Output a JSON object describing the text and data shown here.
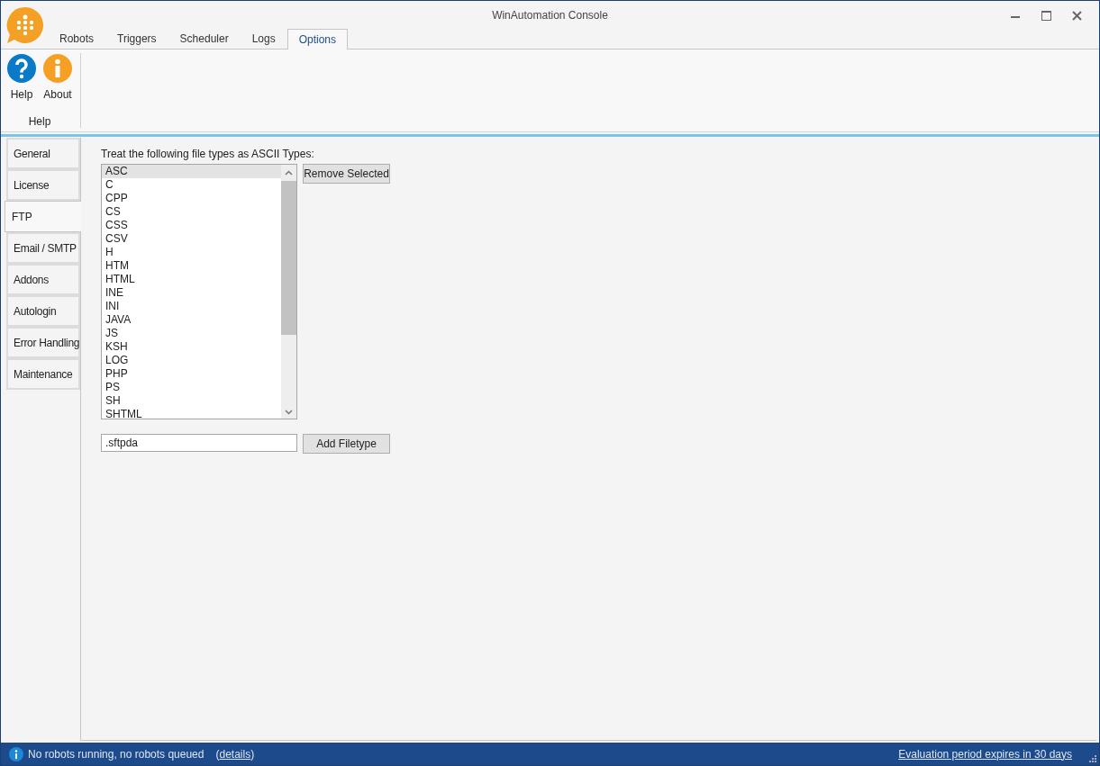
{
  "window": {
    "title": "WinAutomation Console"
  },
  "ribbon_tabs": [
    {
      "label": "Robots",
      "selected": false
    },
    {
      "label": "Triggers",
      "selected": false
    },
    {
      "label": "Scheduler",
      "selected": false
    },
    {
      "label": "Logs",
      "selected": false
    },
    {
      "label": "Options",
      "selected": true
    }
  ],
  "ribbon_buttons": [
    {
      "label": "Help",
      "kind": "help"
    },
    {
      "label": "About",
      "kind": "about"
    }
  ],
  "ribbon_group": "Help",
  "side_tabs": [
    {
      "label": "General",
      "selected": false
    },
    {
      "label": "License",
      "selected": false
    },
    {
      "label": "FTP",
      "selected": true
    },
    {
      "label": "Email / SMTP",
      "selected": false
    },
    {
      "label": "Addons",
      "selected": false
    },
    {
      "label": "Autologin",
      "selected": false
    },
    {
      "label": "Error Handling",
      "selected": false
    },
    {
      "label": "Maintenance",
      "selected": false
    }
  ],
  "ftp": {
    "caption": "Treat the following file types as ASCII Types:",
    "file_types": [
      {
        "label": "ASC",
        "selected": true
      },
      {
        "label": "C",
        "selected": false
      },
      {
        "label": "CPP",
        "selected": false
      },
      {
        "label": "CS",
        "selected": false
      },
      {
        "label": "CSS",
        "selected": false
      },
      {
        "label": "CSV",
        "selected": false
      },
      {
        "label": "H",
        "selected": false
      },
      {
        "label": "HTM",
        "selected": false
      },
      {
        "label": "HTML",
        "selected": false
      },
      {
        "label": "INE",
        "selected": false
      },
      {
        "label": "INI",
        "selected": false
      },
      {
        "label": "JAVA",
        "selected": false
      },
      {
        "label": "JS",
        "selected": false
      },
      {
        "label": "KSH",
        "selected": false
      },
      {
        "label": "LOG",
        "selected": false
      },
      {
        "label": "PHP",
        "selected": false
      },
      {
        "label": "PS",
        "selected": false
      },
      {
        "label": "SH",
        "selected": false
      },
      {
        "label": "SHTML",
        "selected": false
      }
    ],
    "remove_button": "Remove Selected",
    "new_filetype": ".sftpda",
    "add_button": "Add Filetype"
  },
  "status_bar": {
    "message": "No robots running, no robots queued",
    "open_paren": "(",
    "link": "details",
    "close_paren": ")",
    "evaluation": "Evaluation period expires in 30 days"
  }
}
